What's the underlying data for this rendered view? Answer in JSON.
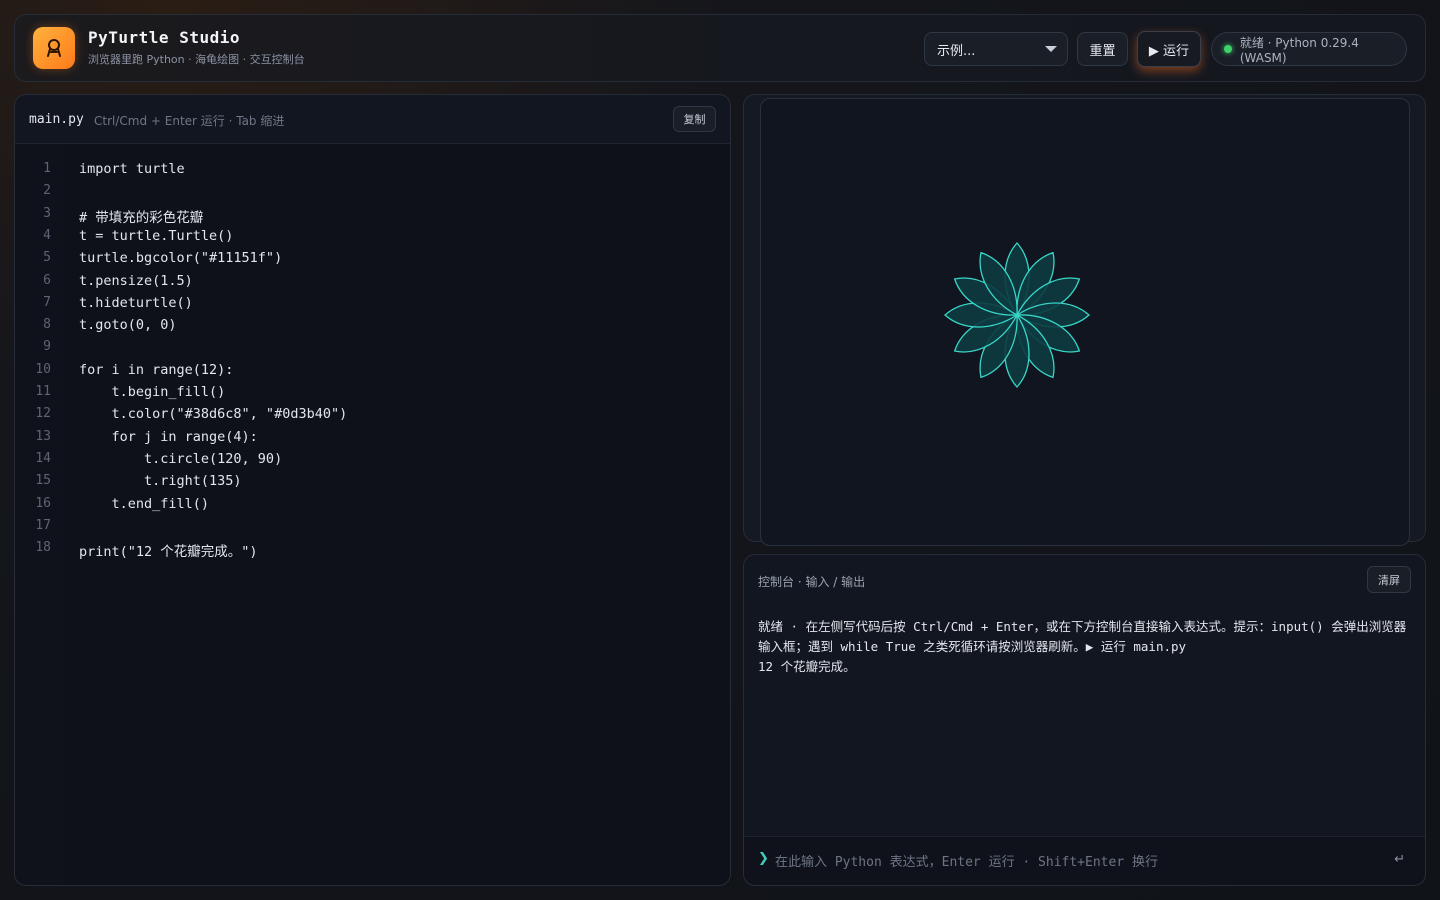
{
  "header": {
    "title": "PyTurtle Studio",
    "subtitle": "浏览器里跑 Python · 海龟绘图 · 交互控制台",
    "examples_label": "示例...",
    "reset_label": "重置",
    "run_label": "▶ 运行",
    "status_text": "就绪 · Python 0.29.4 (WASM)"
  },
  "editor": {
    "filename": "main.py",
    "hint": "Ctrl/Cmd + Enter 运行 · Tab 缩进",
    "copy_label": "复制",
    "line_numbers": [
      "1",
      "2",
      "3",
      "4",
      "5",
      "6",
      "7",
      "8",
      "9",
      "10",
      "11",
      "12",
      "13",
      "14",
      "15",
      "16",
      "17",
      "18"
    ],
    "lines": [
      "import turtle",
      "",
      "# 带填充的彩色花瓣",
      "t = turtle.Turtle()",
      "turtle.bgcolor(\"#11151f\")",
      "t.pensize(1.5)",
      "t.hideturtle()",
      "t.goto(0, 0)",
      "",
      "for i in range(12):",
      "    t.begin_fill()",
      "    t.color(\"#38d6c8\", \"#0d3b40\")",
      "    for j in range(4):",
      "        t.circle(120, 90)",
      "        t.right(135)",
      "    t.end_fill()",
      "",
      "print(\"12 个花瓣完成。\")"
    ]
  },
  "canvas": {
    "background": "#11151f",
    "stroke_color": "#38d6c8",
    "fill_color": "#0d3b40",
    "petal_angles": [
      0,
      30,
      60,
      90,
      120,
      150,
      180,
      210,
      240,
      270,
      300,
      330
    ]
  },
  "console": {
    "title": "控制台 · 输入 / 输出",
    "clear_label": "清屏",
    "output": [
      "就绪 · 在左侧写代码后按 Ctrl/Cmd + Enter，或在下方控制台直接输入表达式。提示：input() 会弹出浏览器输入框；遇到 while True 之类死循环请按浏览器刷新。▶ 运行 main.py",
      "12 个花瓣完成。"
    ],
    "prompt_symbol": "❯",
    "input_placeholder": "在此输入 Python 表达式，Enter 运行 · Shift+Enter 换行",
    "enter_symbol": "↵"
  },
  "colors": {
    "accent_orange": "#ff8a1f",
    "status_green": "#3fd26a",
    "teal": "#38d6c8"
  }
}
